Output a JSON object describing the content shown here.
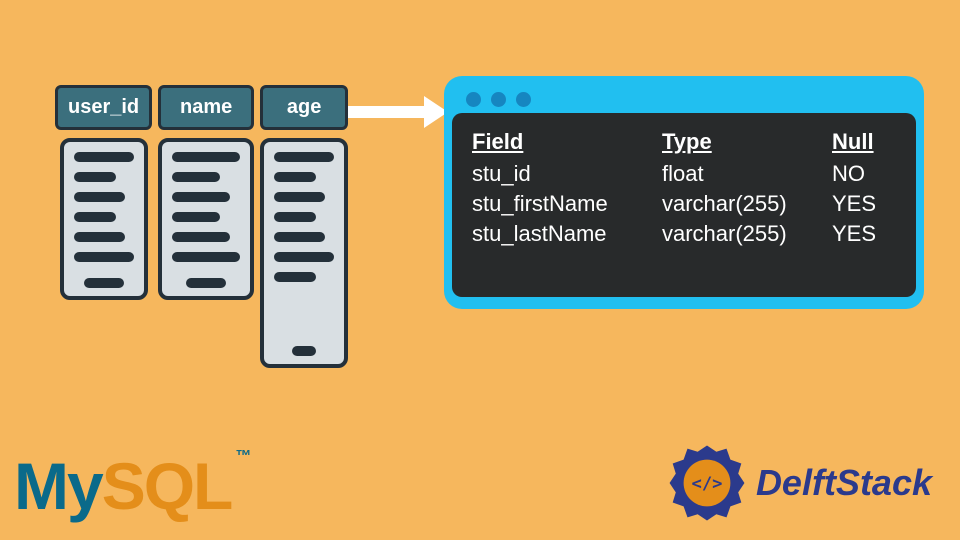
{
  "db_columns": [
    {
      "name": "user_id"
    },
    {
      "name": "name"
    },
    {
      "name": "age"
    }
  ],
  "terminal": {
    "headers": {
      "field": "Field",
      "type": "Type",
      "null": "Null"
    },
    "rows": [
      {
        "field": "stu_id",
        "type": "float",
        "null": "NO"
      },
      {
        "field": "stu_firstName",
        "type": "varchar(255)",
        "null": "YES"
      },
      {
        "field": "stu_lastName",
        "type": "varchar(255)",
        "null": "YES"
      }
    ]
  },
  "brands": {
    "mysql_my": "My",
    "mysql_sql": "SQL",
    "mysql_tm": "™",
    "delftstack": "DelftStack",
    "delft_badge": "</>"
  }
}
